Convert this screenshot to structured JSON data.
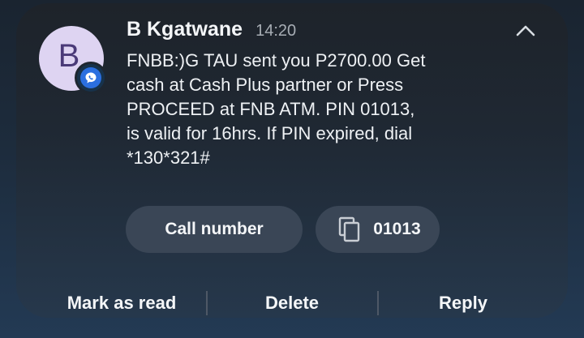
{
  "notification": {
    "avatar_letter": "B",
    "sender": "B Kgatwane",
    "time": "14:20",
    "message": "FNBB:)G TAU sent you P2700.00 Get\ncash at Cash Plus partner or Press\nPROCEED at FNB ATM. PIN 01013,\nis valid for 16hrs. If PIN expired, dial\n*130*321#",
    "icons": {
      "app_badge": "messages-app-icon",
      "collapse": "chevron-up-icon",
      "copy": "copy-icon"
    }
  },
  "chips": {
    "call_label": "Call number",
    "copy_label": "01013"
  },
  "actions": {
    "mark_read_label": "Mark as read",
    "delete_label": "Delete",
    "reply_label": "Reply"
  },
  "colors": {
    "avatar_bg": "#ded4f2",
    "avatar_letter": "#4a3a78",
    "badge_accent": "#2b6fe0",
    "chip_bg": "#3a4656",
    "text_primary": "#f4f6f8",
    "text_secondary": "#a7adb4"
  }
}
